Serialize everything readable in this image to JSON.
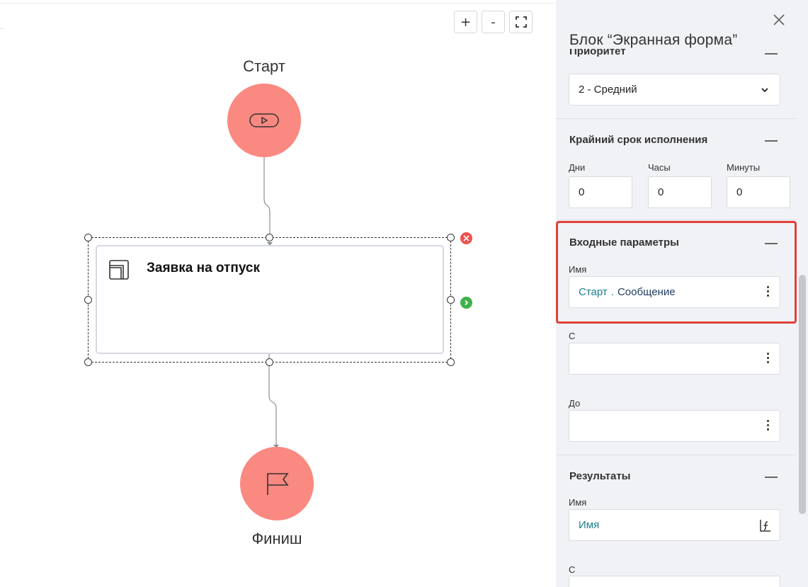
{
  "canvas": {
    "zoom_in_label": "+",
    "zoom_out_label": "-",
    "start_label": "Старт",
    "finish_label": "Финиш",
    "task_title": "Заявка на отпуск"
  },
  "panel": {
    "title": "Блок “Экранная форма”",
    "priority": {
      "section_title": "Приоритет",
      "selected_value": "2 - Средний"
    },
    "deadline": {
      "section_title": "Крайний срок исполнения",
      "days_label": "Дни",
      "days_value": "0",
      "hours_label": "Часы",
      "hours_value": "0",
      "minutes_label": "Минуты",
      "minutes_value": "0"
    },
    "input_params": {
      "section_title": "Входные параметры",
      "name_label": "Имя",
      "name_ref_source": "Старт",
      "name_ref_dot": ".",
      "name_ref_field": "Сообщение",
      "from_label": "С",
      "from_value": "",
      "to_label": "До",
      "to_value": ""
    },
    "results": {
      "section_title": "Результаты",
      "name_label": "Имя",
      "name_placeholder": "Имя",
      "from_label": "С"
    }
  },
  "colors": {
    "node_fill": "#fa8981",
    "highlight": "#e0413a",
    "delete": "#ef5350",
    "next": "#3fb24a",
    "reference": "#1a7f8e"
  },
  "icons": [
    "zoom-in-icon",
    "zoom-out-icon",
    "fit-screen-icon",
    "play-icon",
    "form-icon",
    "flag-icon",
    "close-icon",
    "chevron-down-icon",
    "kebab-icon",
    "function-icon",
    "delete-icon",
    "next-arrow-icon"
  ]
}
